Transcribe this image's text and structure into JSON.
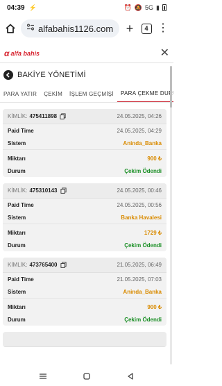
{
  "status_bar": {
    "time": "04:39",
    "usb_glyph": "⚡",
    "signal_glyph": "5G"
  },
  "browser": {
    "url": "alfabahis1126.com",
    "tab_count": "4"
  },
  "site": {
    "logo_text": "alfa bahis",
    "logo_mark": "α"
  },
  "page": {
    "title": "BAKİYE YÖNETİMİ",
    "tabs": [
      {
        "label": "PARA YATIR"
      },
      {
        "label": "ÇEKİM"
      },
      {
        "label": "İŞLEM GEÇMİŞİ"
      },
      {
        "label": "PARA ÇEKME DURUMU"
      }
    ]
  },
  "transactions": [
    {
      "kimlik_label": "KİMLİK:",
      "id": "475411898",
      "created": "24.05.2025, 04:26",
      "paid_time_label": "Paid Time",
      "paid_time": "24.05.2025, 04:29",
      "sistem_label": "Sistem",
      "sistem": "Aninda_Banka",
      "miktar_label": "Miktarı",
      "miktar": "900 ₺",
      "durum_label": "Durum",
      "durum": "Çekim Ödendi"
    },
    {
      "kimlik_label": "KİMLİK:",
      "id": "475310143",
      "created": "24.05.2025, 00:46",
      "paid_time_label": "Paid Time",
      "paid_time": "24.05.2025, 00:56",
      "sistem_label": "Sistem",
      "sistem": "Banka Havalesi",
      "miktar_label": "Miktarı",
      "miktar": "1729 ₺",
      "durum_label": "Durum",
      "durum": "Çekim Ödendi"
    },
    {
      "kimlik_label": "KİMLİK:",
      "id": "473765400",
      "created": "21.05.2025, 06:49",
      "paid_time_label": "Paid Time",
      "paid_time": "21.05.2025, 07:03",
      "sistem_label": "Sistem",
      "sistem": "Aninda_Banka",
      "miktar_label": "Miktarı",
      "miktar": "900 ₺",
      "durum_label": "Durum",
      "durum": "Çekim Ödendi"
    }
  ],
  "colors": {
    "accent": "#c81e2c",
    "amount": "#d98b00",
    "success": "#1a8f25"
  },
  "icons": [
    "home-icon",
    "site-settings-icon",
    "new-tab-icon",
    "tab-switcher-icon",
    "overflow-menu-icon",
    "close-icon",
    "back-arrow-icon",
    "copy-icon",
    "nav-recents-icon",
    "nav-home-icon",
    "nav-back-icon"
  ]
}
